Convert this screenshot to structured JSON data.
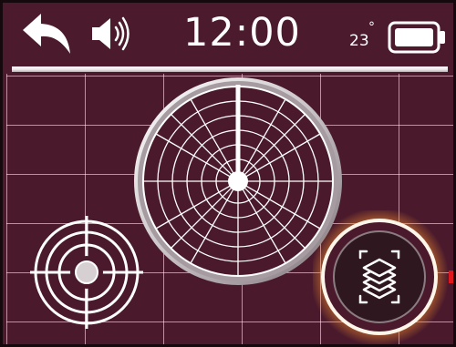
{
  "status_bar": {
    "time": "12:00",
    "temperature": "23",
    "temperature_unit": "°",
    "icons": {
      "back": "back-arrow-icon",
      "volume": "speaker-volume-icon",
      "battery": "battery-full-icon"
    }
  },
  "main": {
    "radar": {
      "icon": "radar-scan-icon"
    },
    "target_button": {
      "icon": "crosshair-target-icon"
    },
    "layers_button": {
      "icon": "layers-icon",
      "selected": true
    }
  },
  "colors": {
    "background": "#4b1a2c",
    "grid_lines": "#b8a2aa",
    "foreground": "#ffffff",
    "highlight_glow": "#f4a24a",
    "indicator": "#e0171c"
  }
}
